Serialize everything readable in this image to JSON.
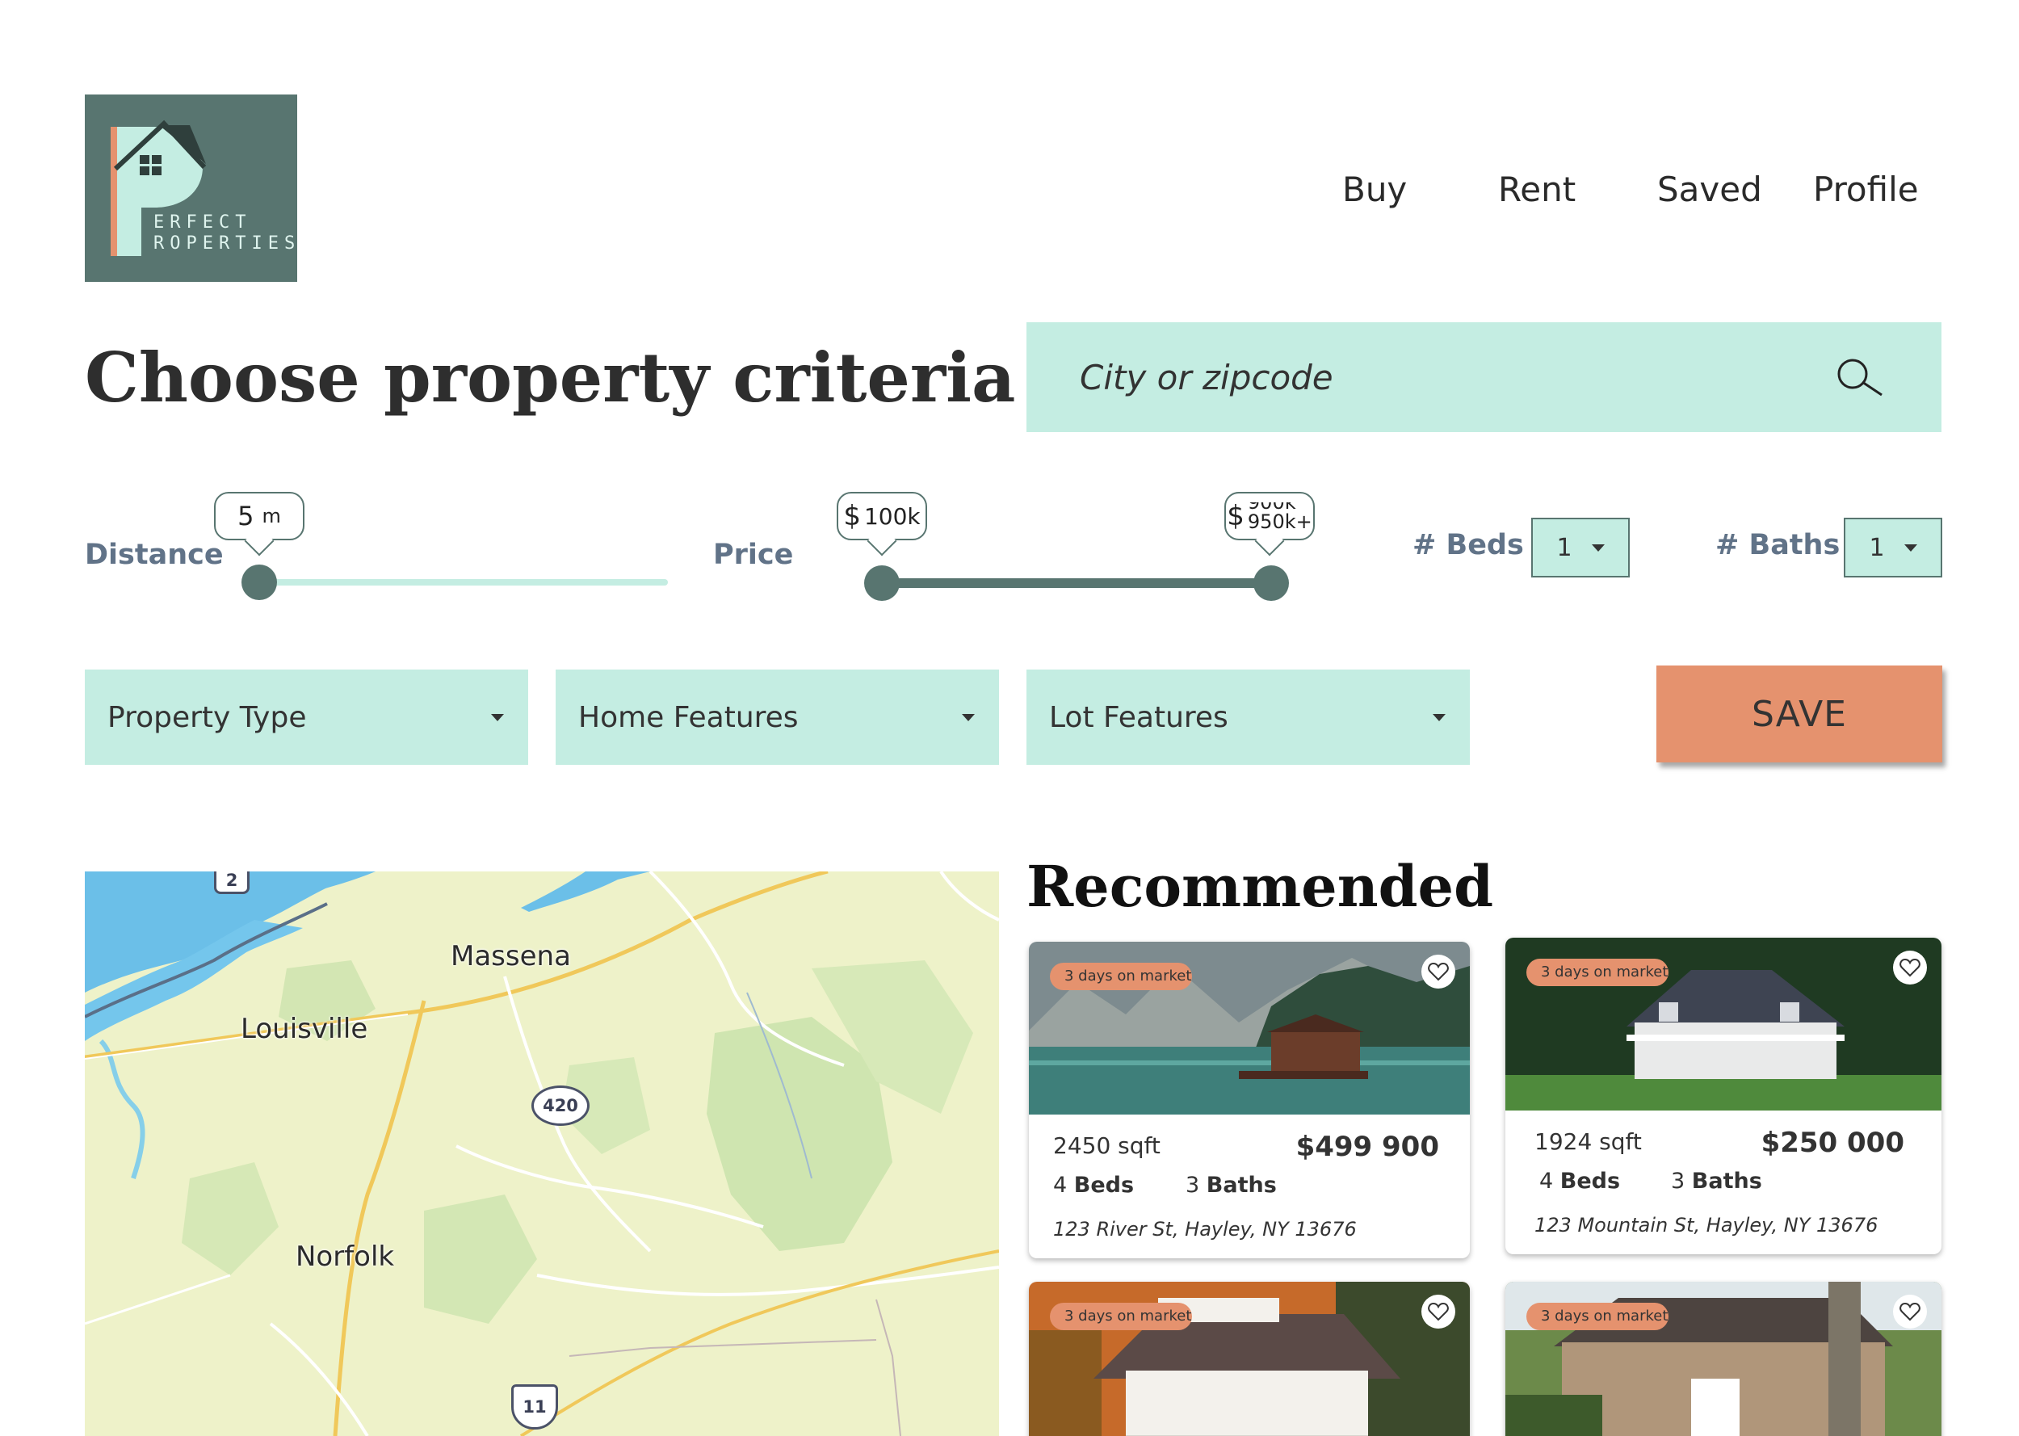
{
  "brand": {
    "logo_line1": "ERFECT",
    "logo_line2": "ROPERTIES"
  },
  "nav": {
    "buy": "Buy",
    "rent": "Rent",
    "saved": "Saved",
    "profile": "Profile"
  },
  "page_title": "Choose property criteria",
  "search": {
    "placeholder": "City or zipcode",
    "icon": "search-icon"
  },
  "filters": {
    "distance": {
      "label": "Distance",
      "value": "5",
      "unit": "m",
      "fill_fraction": 0.0
    },
    "price": {
      "label": "Price",
      "min_currency": "$",
      "min_value": "100k",
      "max_currency": "$",
      "max_value_top": "900k",
      "max_value": "950k+"
    },
    "beds": {
      "label": "# Beds",
      "value": "1"
    },
    "baths": {
      "label": "# Baths",
      "value": "1"
    },
    "property_type": "Property Type",
    "home_features": "Home Features",
    "lot_features": "Lot Features",
    "save_label": "SAVE"
  },
  "map": {
    "labels": {
      "massena": "Massena",
      "louisville": "Louisville",
      "norfolk": "Norfolk"
    },
    "shields": {
      "r2": "2",
      "r420": "420",
      "r11": "11"
    }
  },
  "recommended": {
    "title": "Recommended",
    "listings": [
      {
        "badge": "3 days on market",
        "sqft": "2450 sqft",
        "price": "$499 900",
        "beds_num": "4",
        "beds_label": "Beds",
        "baths_num": "3",
        "baths_label": "Baths",
        "address": "123 River St, Hayley, NY 13676"
      },
      {
        "badge": "3 days on market",
        "sqft": "1924 sqft",
        "price": "$250 000",
        "beds_num": "4",
        "beds_label": "Beds",
        "baths_num": "3",
        "baths_label": "Baths",
        "address": "123 Mountain St, Hayley, NY 13676"
      },
      {
        "badge": "3 days on market"
      },
      {
        "badge": "3 days on market"
      }
    ]
  },
  "colors": {
    "brand": "#587570",
    "mint": "#c4ede2",
    "accent": "#e5926e"
  }
}
